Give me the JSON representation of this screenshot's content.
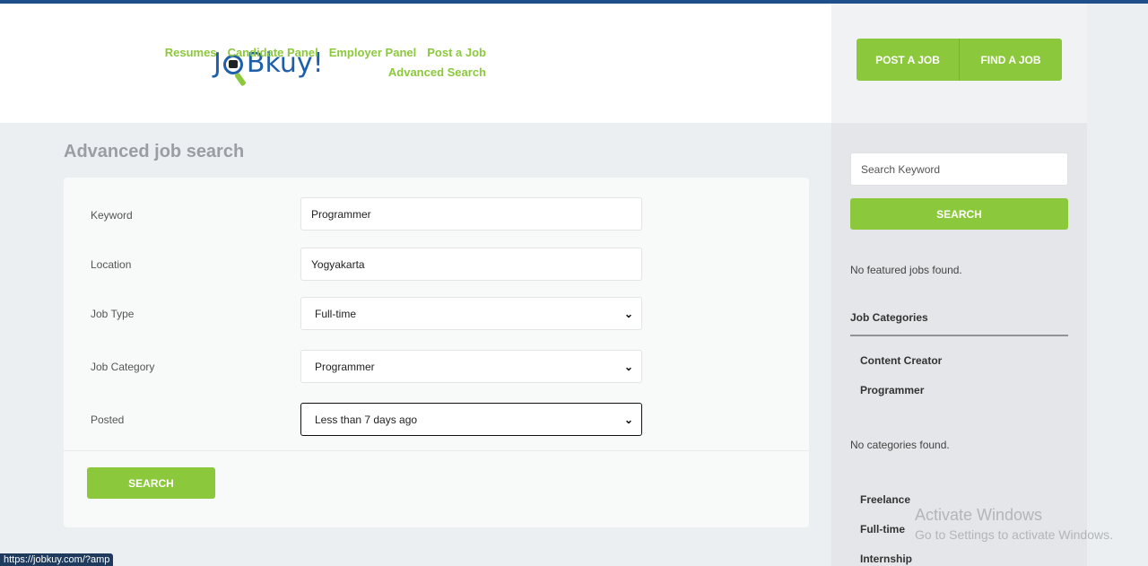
{
  "brand": {
    "logo_left": "J",
    "logo_right": "Bkuy!",
    "accent": "#8cc83c",
    "logo_color": "#1f5fa8"
  },
  "nav": {
    "items": [
      "Resumes",
      "Candidate Panel",
      "Employer Panel",
      "Post a Job",
      "Advanced Search"
    ]
  },
  "header_buttons": {
    "post": "POST A JOB",
    "find": "FIND A JOB"
  },
  "page": {
    "title": "Advanced job search"
  },
  "form": {
    "keyword": {
      "label": "Keyword",
      "value": "Programmer"
    },
    "location": {
      "label": "Location",
      "value": "Yogyakarta"
    },
    "job_type": {
      "label": "Job Type",
      "value": "Full-time"
    },
    "job_category": {
      "label": "Job Category",
      "value": "Programmer"
    },
    "posted": {
      "label": "Posted",
      "value": "Less than 7 days ago"
    },
    "submit": "SEARCH"
  },
  "sidebar": {
    "search_placeholder": "Search Keyword",
    "search_button": "SEARCH",
    "no_featured": "No featured jobs found.",
    "categories_heading": "Job Categories",
    "categories": [
      "Content Creator",
      "Programmer"
    ],
    "no_categories": "No categories found.",
    "job_types": [
      "Freelance",
      "Full-time",
      "Internship"
    ]
  },
  "watermark": {
    "title": "Activate Windows",
    "subtitle": "Go to Settings to activate Windows."
  },
  "status_bar": {
    "url": "https://jobkuy.com/?amp"
  },
  "icons": {
    "select_chevron": "chevron-down-icon",
    "logo_lens": "magnifier-icon"
  }
}
